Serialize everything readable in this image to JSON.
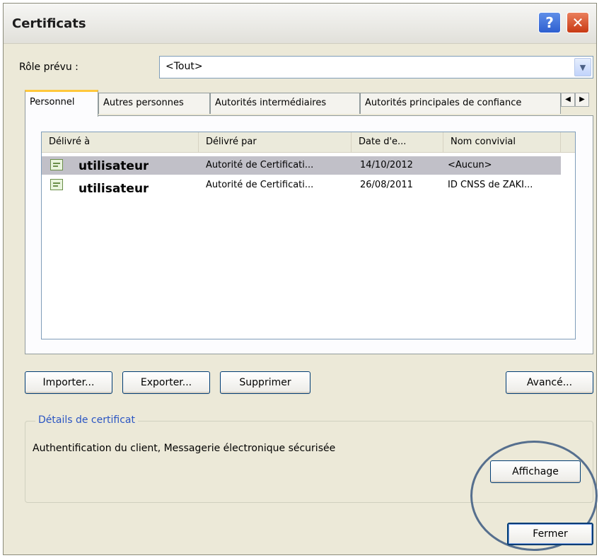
{
  "window": {
    "title": "Certificats",
    "help_glyph": "?",
    "close_glyph": "✕"
  },
  "role": {
    "label": "Rôle prévu :",
    "value": "<Tout>",
    "arrow": "▼"
  },
  "tabs": [
    {
      "label": "Personnel"
    },
    {
      "label": "Autres personnes"
    },
    {
      "label": "Autorités intermédiaires"
    },
    {
      "label": "Autorités principales de confiance"
    }
  ],
  "tab_scroll": {
    "left": "◀",
    "right": "▶"
  },
  "list": {
    "columns": [
      "Délivré à",
      "Délivré par",
      "Date d'e...",
      "Nom convivial"
    ],
    "rows": [
      {
        "issued_to": "utilisateur",
        "issued_by": "Autorité de Certificati...",
        "date": "14/10/2012",
        "friendly": "<Aucun>",
        "selected": true
      },
      {
        "issued_to": "utilisateur",
        "issued_by": "Autorité de Certificati...",
        "date": "26/08/2011",
        "friendly": "ID CNSS de ZAKI...",
        "selected": false
      }
    ]
  },
  "buttons": {
    "import": "Importer...",
    "export": "Exporter...",
    "delete": "Supprimer",
    "advanced": "Avancé...",
    "view": "Affichage",
    "close": "Fermer"
  },
  "details": {
    "title": "Détails de certificat",
    "text": "Authentification du client, Messagerie électronique sécurisée"
  },
  "icons": {
    "certificate": "certificate-icon",
    "annotation": "highlight-ellipse"
  }
}
